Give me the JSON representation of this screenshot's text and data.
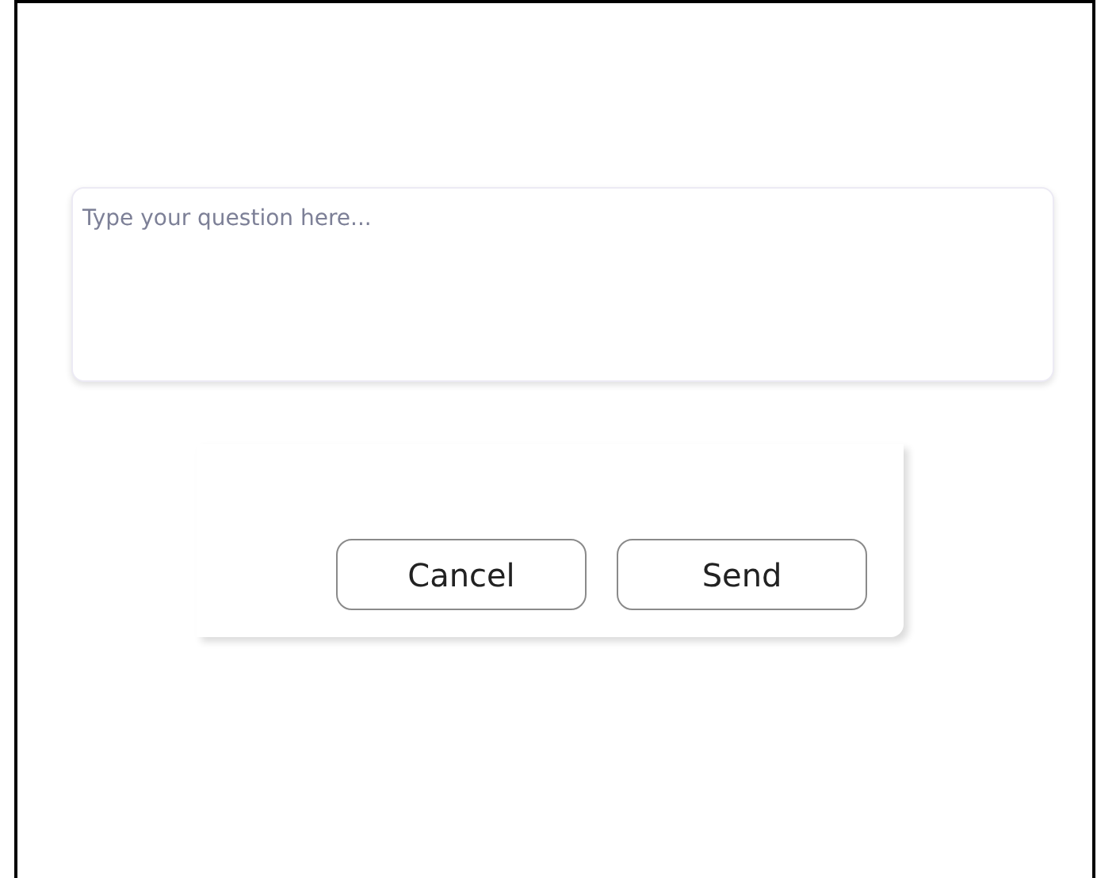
{
  "question": {
    "placeholder": "Type your question here..."
  },
  "buttons": [
    {
      "label": "Cancel"
    },
    {
      "label": "Send"
    }
  ]
}
